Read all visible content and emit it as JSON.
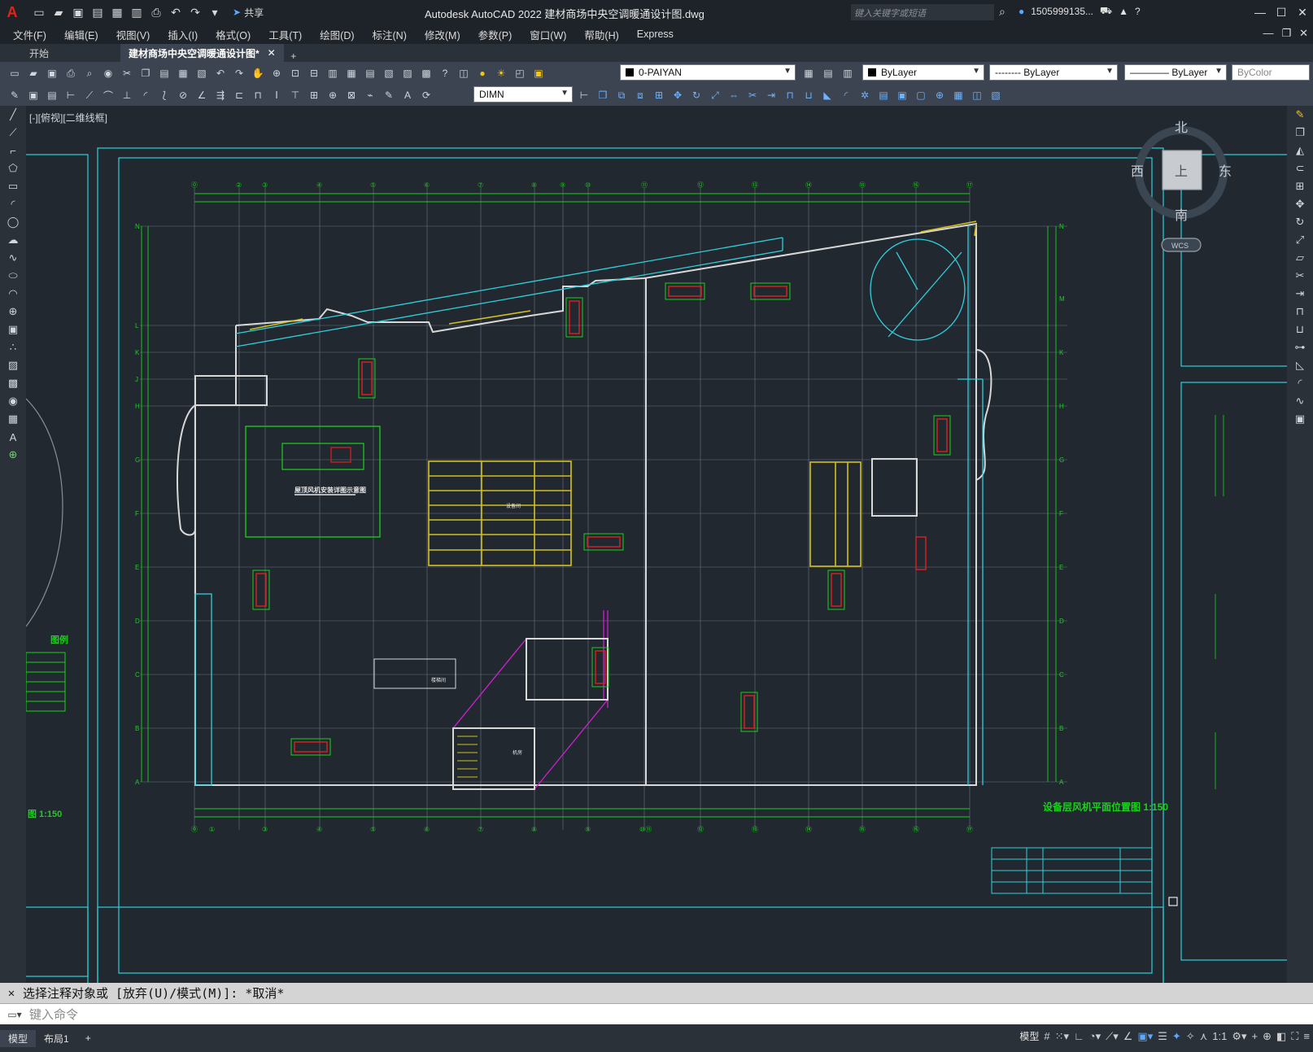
{
  "app": {
    "title": "Autodesk AutoCAD 2022    建材商场中央空调暖通设计图.dwg",
    "share_label": "共享",
    "search_placeholder": "键入关键字或短语",
    "user": "1505999135..."
  },
  "menu": [
    "文件(F)",
    "编辑(E)",
    "视图(V)",
    "插入(I)",
    "格式(O)",
    "工具(T)",
    "绘图(D)",
    "标注(N)",
    "修改(M)",
    "参数(P)",
    "窗口(W)",
    "帮助(H)",
    "Express"
  ],
  "tabs": {
    "start": "开始",
    "active": "建材商场中央空调暖通设计图*"
  },
  "toolbar": {
    "layer": "0-PAIYAN",
    "dim_style": "DIMN",
    "color": "ByLayer",
    "linetype": "-------- ByLayer",
    "lineweight": "———— ByLayer",
    "plotstyle": "ByColor"
  },
  "viewport": {
    "label": "[-][俯视][二维线框]",
    "viewcube": {
      "north": "北",
      "south": "南",
      "east": "东",
      "west": "西",
      "top": "上",
      "wcs": "WCS"
    }
  },
  "drawing": {
    "plan_title": "设备层风机平面位置图 1:150",
    "left_title_fragment": "图 1:150",
    "legend_header": "图例",
    "col_labels_top": [
      "⓪",
      "②",
      "③",
      "④",
      "⑤",
      "⑥",
      "⑦",
      "⑧",
      "⑨",
      "⑩",
      "⑪",
      "⑫",
      "⑬",
      "⑭",
      "⑮",
      "⑯",
      "⑰"
    ],
    "col_labels_bottom": [
      "⓪",
      "①",
      "③",
      "④",
      "⑤",
      "⑥",
      "⑦",
      "⑧",
      "⑨",
      "⑩⑪",
      "⑫",
      "⑬",
      "⑭",
      "⑮",
      "⑯",
      "⑰"
    ],
    "row_labels_left": [
      "N",
      "L",
      "K",
      "J",
      "H",
      "G",
      "F",
      "E",
      "D",
      "C",
      "B",
      "A"
    ],
    "row_labels_right": [
      "N",
      "M",
      "K",
      "H",
      "G",
      "F",
      "E",
      "D",
      "C",
      "B",
      "A"
    ],
    "detail_title": "屋顶风机安装详图示意图",
    "stair_label": "楼梯间",
    "room_label_1": "设备间",
    "room_label_2": "机房"
  },
  "command": {
    "history": "选择注释对象或 [放弃(U)/模式(M)]: *取消*",
    "placeholder": "键入命令"
  },
  "status": {
    "tabs": [
      "模型",
      "布局1"
    ],
    "model_label": "模型",
    "scale": "1:1"
  }
}
